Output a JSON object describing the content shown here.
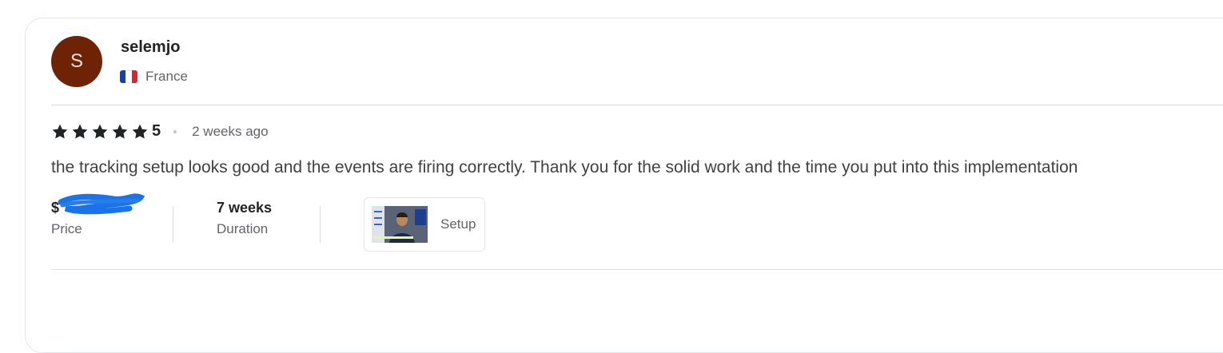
{
  "review": {
    "avatar_initial": "S",
    "username": "selemjo",
    "country": "France",
    "flag_icon": "france-flag-icon",
    "rating": "5",
    "stars_filled": 5,
    "stars_total": 5,
    "time_ago": "2 weeks ago",
    "text": "the tracking setup looks good and the events are firing correctly. Thank you for the solid work and the time you put into this implementation",
    "price_value": "$",
    "price_label": "Price",
    "duration_value": "7 weeks",
    "duration_label": "Duration",
    "deliverable_label": "Setup"
  },
  "colors": {
    "avatar_bg": "#6e2307",
    "star": "#222325",
    "scribble": "#1a73e8"
  }
}
